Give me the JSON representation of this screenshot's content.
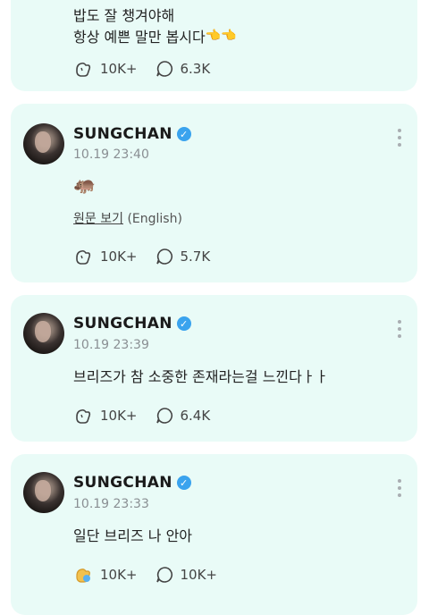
{
  "posts": [
    {
      "author": "",
      "time": "",
      "text_lines": [
        "밥도 잘 챙겨야해",
        "항상 예쁜 말만 봅시다"
      ],
      "emoji": "👈👈",
      "likes": "10K+",
      "comments": "6.3K"
    },
    {
      "author": "SUNGCHAN",
      "time": "10.19 23:40",
      "emoji": "🦛",
      "translate_label": "원문 보기",
      "translate_lang": "(English)",
      "likes": "10K+",
      "comments": "5.7K"
    },
    {
      "author": "SUNGCHAN",
      "time": "10.19 23:39",
      "text": "브리즈가 참 소중한 존재라는걸 느낀다ㅏㅏ",
      "likes": "10K+",
      "comments": "6.4K"
    },
    {
      "author": "SUNGCHAN",
      "time": "10.19 23:33",
      "text": "일단 브리즈 나 안아",
      "likes": "10K+",
      "comments": "10K+"
    }
  ],
  "icons": {
    "like": "like-icon",
    "like_active": "like-active-icon",
    "comment": "comment-icon",
    "more": "more-icon",
    "verified": "verified-badge-icon"
  },
  "colors": {
    "card_bg": "#e9fbf7",
    "verified": "#3aa3ee",
    "muted": "#8a8f93",
    "like_active": "#f2c14e"
  }
}
